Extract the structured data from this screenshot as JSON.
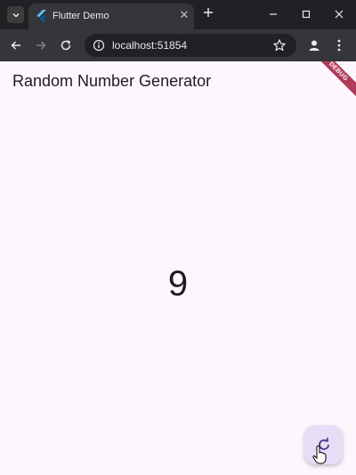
{
  "browser": {
    "tab": {
      "title": "Flutter Demo"
    },
    "address_bar": {
      "url": "localhost:51854"
    },
    "colors": {
      "frame": "#202124",
      "toolbar": "#35363a",
      "text": "#e8eaed"
    }
  },
  "app": {
    "title": "Random Number Generator",
    "number": "9",
    "debug_banner": "DEBUG",
    "fab_icon": "refresh-icon",
    "colors": {
      "background": "#fdf7fd",
      "fab": "#e7ddf6",
      "icon": "#4f378b",
      "banner": "#b13b5a"
    }
  }
}
